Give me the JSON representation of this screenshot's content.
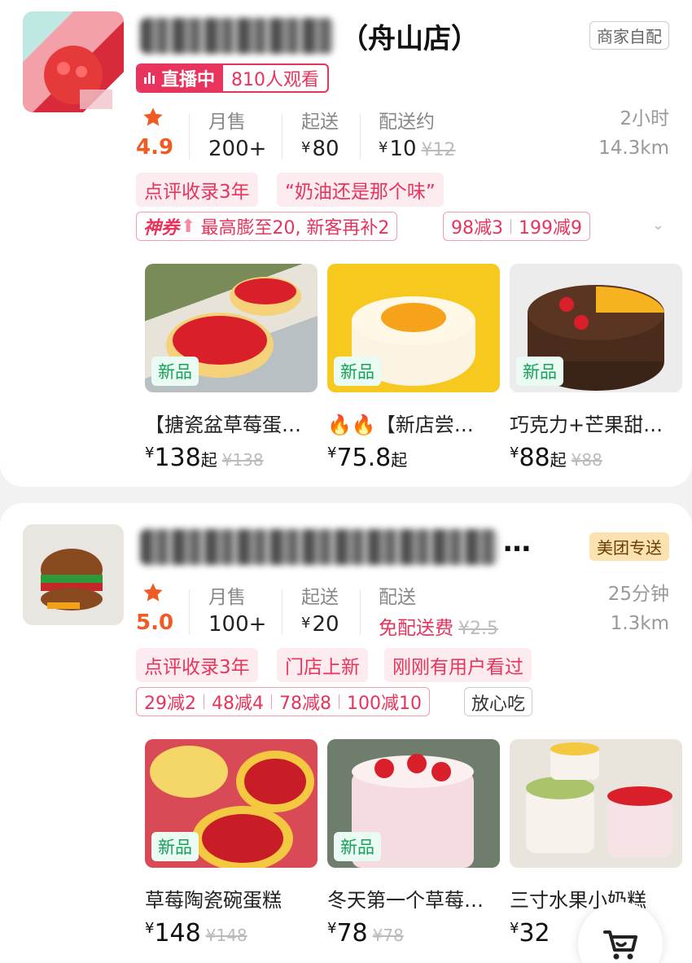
{
  "stores": [
    {
      "name_suffix": "（舟山店）",
      "delivery_tag": "商家自配",
      "live": {
        "label": "直播中",
        "viewers": "810人观看"
      },
      "rating": "4.9",
      "monthly_sales_label": "月售",
      "monthly_sales": "200+",
      "min_order_label": "起送",
      "min_order": "80",
      "delivery_fee_label": "配送约",
      "delivery_fee": "10",
      "delivery_fee_original": "¥12",
      "eta": "2小时",
      "distance": "14.3km",
      "pills": [
        "点评收录3年",
        "“奶油还是那个味”"
      ],
      "coupon_brand": "神券",
      "coupon_text": "最高膨至20, 新客再补2",
      "discounts": [
        "98减3",
        "199减9"
      ],
      "products": [
        {
          "badge": "新品",
          "name": "【搪瓷盆草莓蛋…",
          "price": "138",
          "suffix": "起",
          "original": "¥138"
        },
        {
          "badge": "新品",
          "name": "🔥🔥【新店尝…",
          "price": "75.8",
          "suffix": "起",
          "original": ""
        },
        {
          "badge": "新品",
          "name": "巧克力+芒果甜…",
          "price": "88",
          "suffix": "起",
          "original": "¥88"
        }
      ]
    },
    {
      "name_suffix": "…",
      "delivery_tag": "美团专送",
      "rating": "5.0",
      "monthly_sales_label": "月售",
      "monthly_sales": "100+",
      "min_order_label": "起送",
      "min_order": "20",
      "delivery_fee_label": "配送",
      "delivery_fee": "免配送费",
      "delivery_fee_original": "¥2.5",
      "eta": "25分钟",
      "distance": "1.3km",
      "pills": [
        "点评收录3年",
        "门店上新",
        "刚刚有用户看过"
      ],
      "discounts": [
        "29减2",
        "48减4",
        "78减8",
        "100减10"
      ],
      "extra_tag": "放心吃",
      "products": [
        {
          "badge": "新品",
          "name": "草莓陶瓷碗蛋糕",
          "price": "148",
          "suffix": "",
          "original": "¥148"
        },
        {
          "badge": "新品",
          "name": "冬天第一个草莓…",
          "price": "78",
          "suffix": "",
          "original": "¥78"
        },
        {
          "badge": "",
          "name": "三寸水果小奶糕",
          "price": "32",
          "suffix": "",
          "original": ""
        }
      ]
    }
  ],
  "currency": "¥",
  "colors": {
    "accent": "#e8335c",
    "rating": "#f05a24",
    "new_badge": "#18a05a"
  },
  "icons": {
    "cart": "cart-icon",
    "star": "star-icon",
    "live": "live-bars-icon"
  }
}
